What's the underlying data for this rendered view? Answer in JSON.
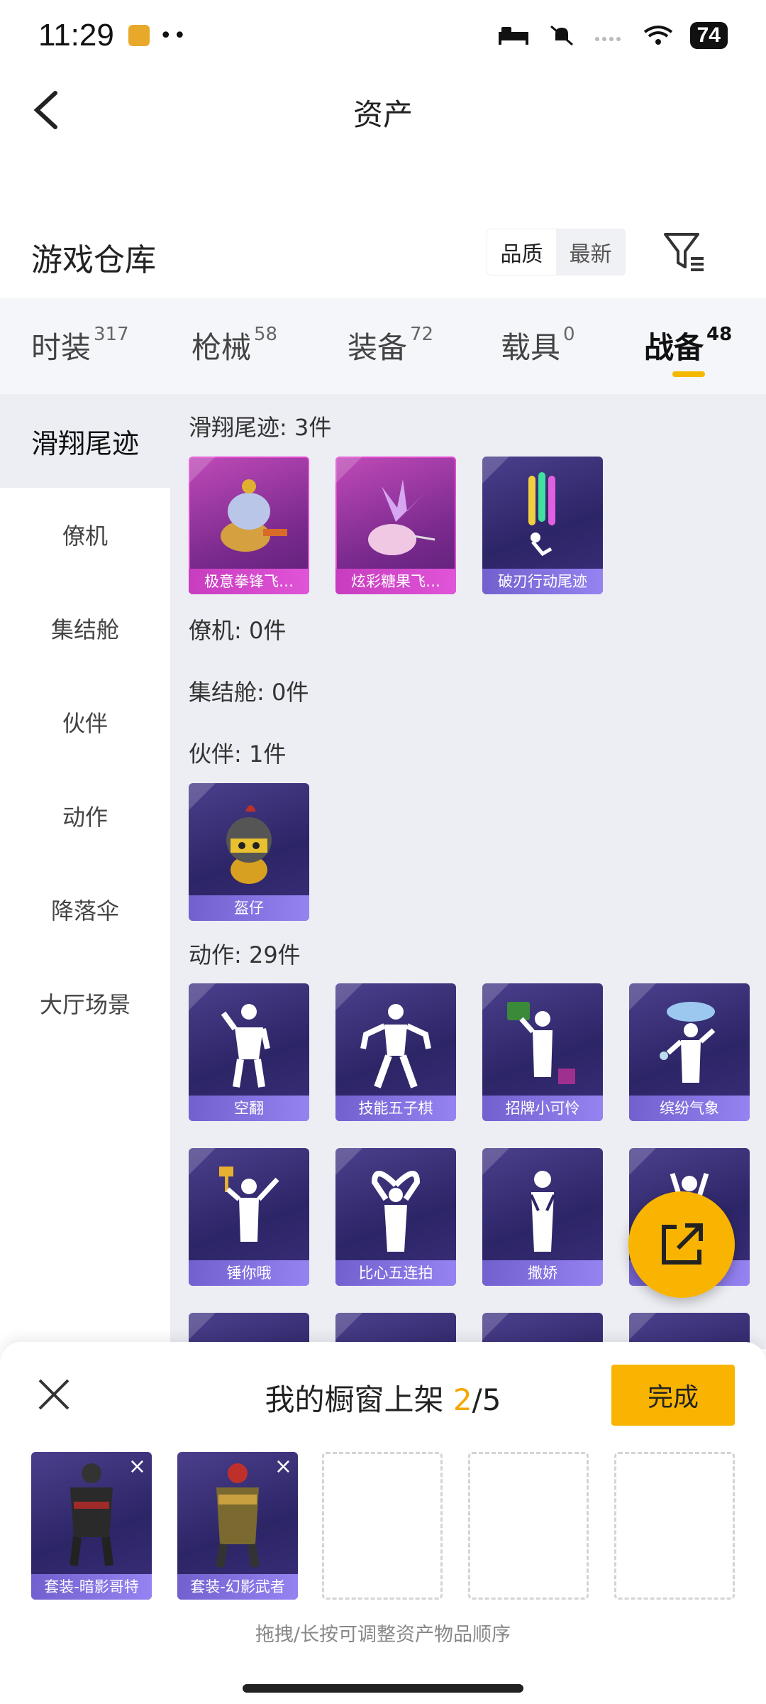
{
  "status": {
    "time": "11:29",
    "dots": "••",
    "battery": "74"
  },
  "header": {
    "title": "资产"
  },
  "warehouse": {
    "title": "游戏仓库",
    "sort_quality": "品质",
    "sort_newest": "最新"
  },
  "tabs": [
    {
      "label": "时装",
      "count": "317"
    },
    {
      "label": "枪械",
      "count": "58"
    },
    {
      "label": "装备",
      "count": "72"
    },
    {
      "label": "载具",
      "count": "0"
    },
    {
      "label": "战备",
      "count": "48",
      "active": true
    }
  ],
  "sidebar": [
    "滑翔尾迹",
    "僚机",
    "集结舱",
    "伙伴",
    "动作",
    "降落伞",
    "大厅场景"
  ],
  "sections": {
    "glide": {
      "label": "滑翔尾迹: 3件",
      "items": [
        "极意拳锋飞…",
        "炫彩糖果飞…",
        "破刃行动尾迹"
      ]
    },
    "wingman": {
      "label": "僚机: 0件"
    },
    "capsule": {
      "label": "集结舱: 0件"
    },
    "partner": {
      "label": "伙伴: 1件",
      "items": [
        "盔仔"
      ]
    },
    "emote": {
      "label": "动作: 29件",
      "items": [
        "空翻",
        "技能五子棋",
        "招牌小可怜",
        "缤纷气象",
        "锤你哦",
        "比心五连拍",
        "撒娇"
      ]
    }
  },
  "bottom": {
    "title_prefix": "我的橱窗上架 ",
    "current": "2",
    "total": "/5",
    "done": "完成",
    "slots": [
      "套装-暗影哥特",
      "套装-幻影武者"
    ],
    "hint": "拖拽/长按可调整资产物品顺序"
  },
  "colors": {
    "accent": "#f8b400",
    "card_bg": "#2c2566",
    "pink_card": "#c04ab8"
  }
}
